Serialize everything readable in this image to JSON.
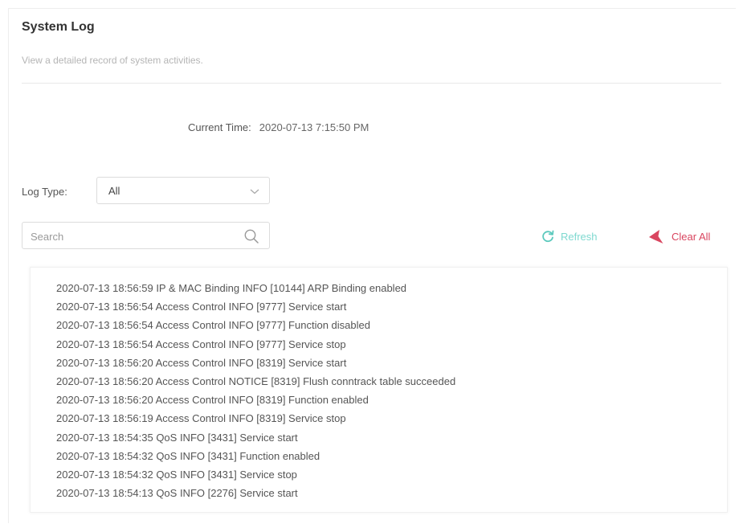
{
  "header": {
    "title": "System Log",
    "subtitle": "View a detailed record of system activities."
  },
  "time": {
    "label": "Current Time:",
    "value": "2020-07-13 7:15:50 PM"
  },
  "log_type": {
    "label": "Log Type:",
    "selected": "All"
  },
  "search": {
    "placeholder": "Search",
    "value": ""
  },
  "actions": {
    "refresh_label": "Refresh",
    "clear_label": "Clear All"
  },
  "colors": {
    "refresh": "#7fd9d0",
    "clear": "#d9455f"
  },
  "logs": [
    "2020-07-13 18:56:59 IP & MAC Binding INFO [10144] ARP Binding enabled",
    "2020-07-13 18:56:54 Access Control INFO [9777] Service start",
    "2020-07-13 18:56:54 Access Control INFO [9777] Function disabled",
    "2020-07-13 18:56:54 Access Control INFO [9777] Service stop",
    "2020-07-13 18:56:20 Access Control INFO [8319] Service start",
    "2020-07-13 18:56:20 Access Control NOTICE [8319] Flush conntrack table succeeded",
    "2020-07-13 18:56:20 Access Control INFO [8319] Function enabled",
    "2020-07-13 18:56:19 Access Control INFO [8319] Service stop",
    "2020-07-13 18:54:35 QoS INFO [3431] Service start",
    "2020-07-13 18:54:32 QoS INFO [3431] Function enabled",
    "2020-07-13 18:54:32 QoS INFO [3431] Service stop",
    "2020-07-13 18:54:13 QoS INFO [2276] Service start"
  ]
}
